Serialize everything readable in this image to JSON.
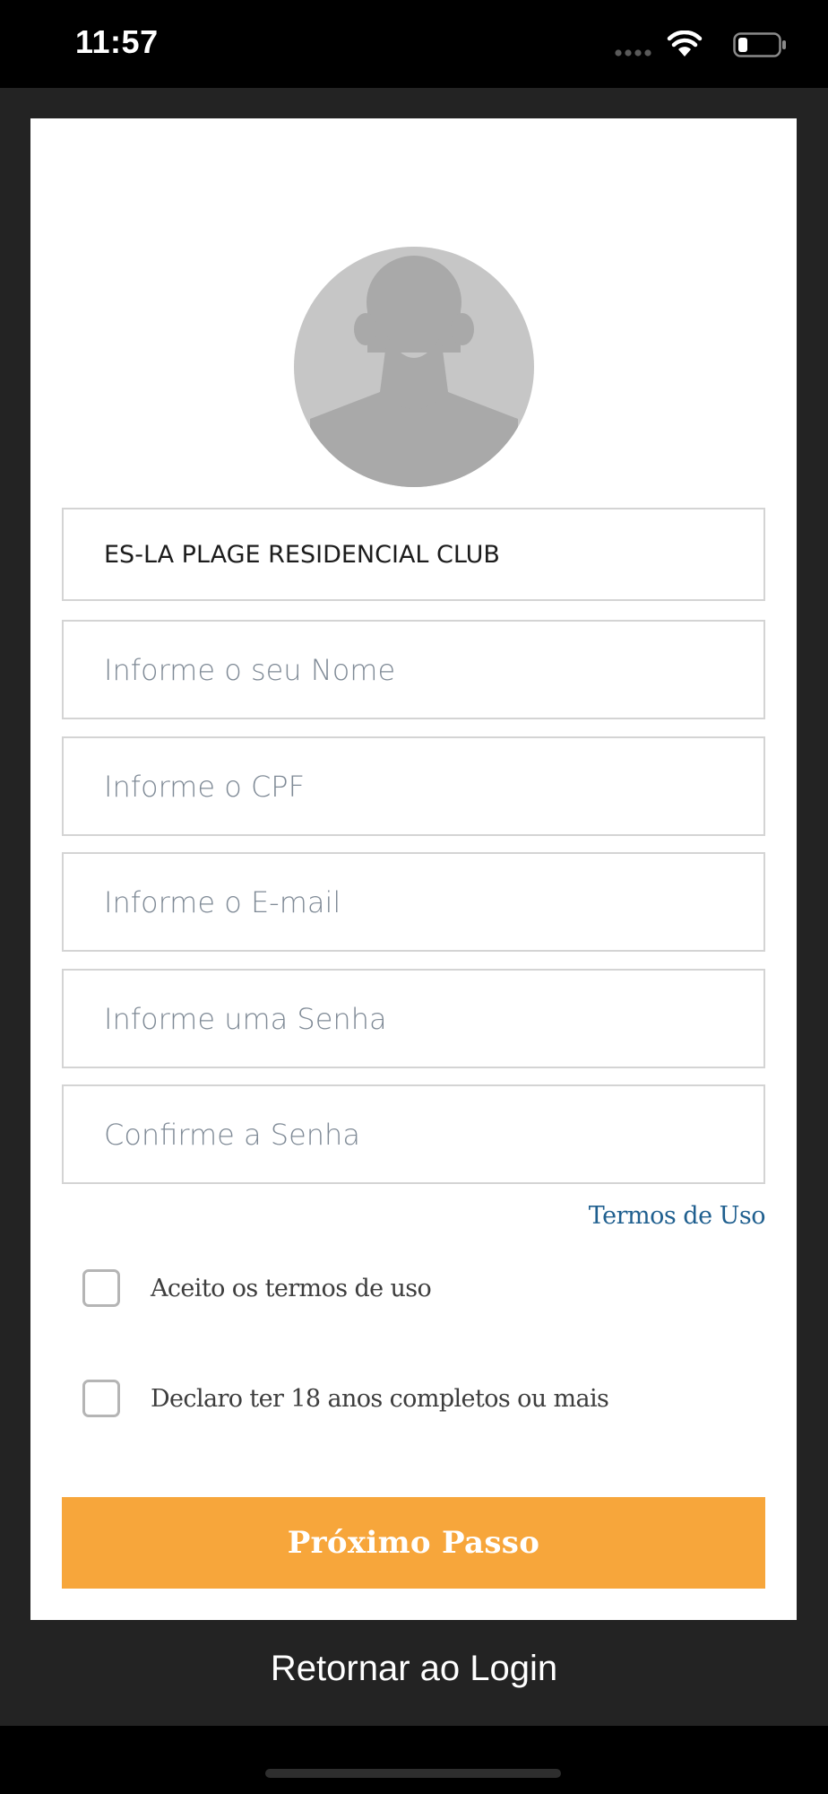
{
  "status_bar": {
    "time": "11:57",
    "icons": [
      "signal-icon",
      "wifi-icon",
      "battery-icon"
    ]
  },
  "form": {
    "avatar": "avatar-placeholder-icon",
    "condominium": "ES-LA PLAGE RESIDENCIAL CLUB",
    "fields": [
      {
        "placeholder": "Informe o seu Nome"
      },
      {
        "placeholder": "Informe o CPF"
      },
      {
        "placeholder": "Informe o E-mail"
      },
      {
        "placeholder": "Informe uma Senha"
      },
      {
        "placeholder": "Confirme a Senha"
      }
    ],
    "terms_link": "Termos de Uso",
    "checks": [
      {
        "label": "Aceito os termos de uso",
        "checked": false
      },
      {
        "label": "Declaro ter 18 anos completos ou mais",
        "checked": false
      }
    ],
    "next_button": "Próximo Passo"
  },
  "footer": {
    "back_link": "Retornar ao Login"
  },
  "colors": {
    "accent": "#f7a63b",
    "link": "#1f5f8f",
    "background": "#232323"
  }
}
